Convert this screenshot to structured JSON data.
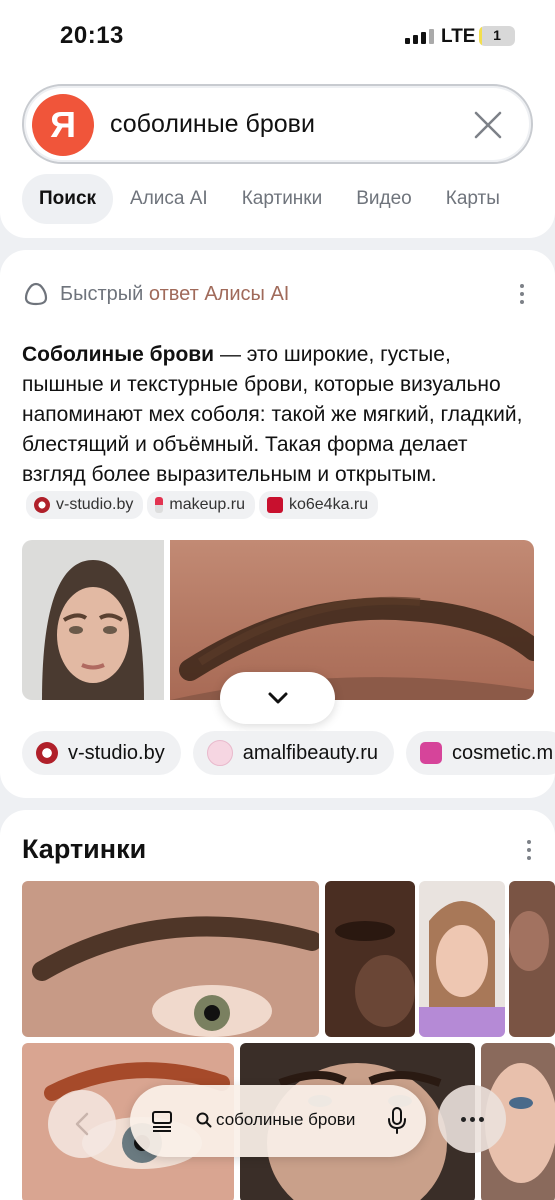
{
  "status_bar": {
    "time": "20:13",
    "network": "LTE",
    "battery": "1",
    "battery_level": 0.08
  },
  "search": {
    "query": "соболиные брови",
    "logo": "Я"
  },
  "tabs": [
    {
      "label": "Поиск",
      "active": true
    },
    {
      "label": "Алиса AI",
      "active": false
    },
    {
      "label": "Картинки",
      "active": false
    },
    {
      "label": "Видео",
      "active": false
    },
    {
      "label": "Карты",
      "active": false
    }
  ],
  "answer": {
    "header_prefix": "Быстрый",
    "header_accent": "ответ Алисы AI",
    "term": "Соболиные брови",
    "text": " — это широкие, густые, пышные и текстурные брови, которые визуально напоминают мех соболя: такой же мягкий, гладкий, блестящий и объёмный. Такая форма делает взгляд более выразительным и открытым.",
    "inline_sources": [
      "v-studio.by",
      "makeup.ru",
      "ko6e4ka.ru"
    ]
  },
  "sources": [
    "v-studio.by",
    "amalfibeauty.ru",
    "cosmetic.m"
  ],
  "images_section": {
    "title": "Картинки"
  },
  "bottom_bar": {
    "search_query": "соболиные брови"
  },
  "colors": {
    "accent": "#f0553a",
    "alice_accent": "#a06a5a",
    "background": "#eef0f3"
  }
}
